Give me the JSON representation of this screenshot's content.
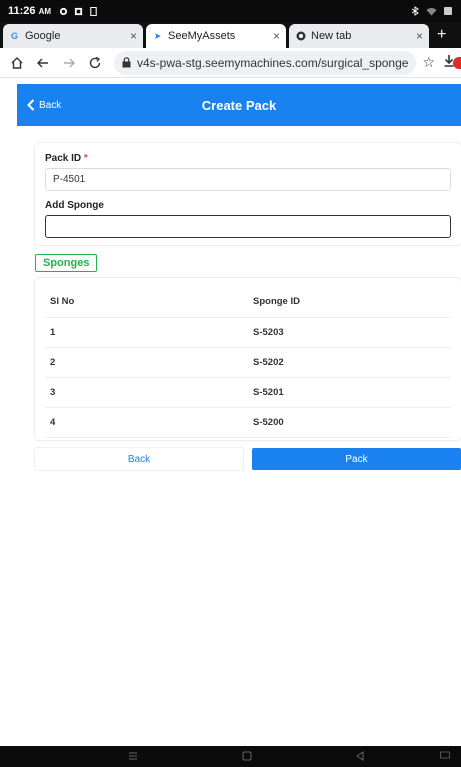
{
  "status_bar": {
    "time": "11:26",
    "ampm": "AM"
  },
  "browser": {
    "tabs": [
      {
        "label": "Google",
        "favicon": "google-icon",
        "active": false
      },
      {
        "label": "SeeMyAssets",
        "favicon": "seemyassets-icon",
        "active": true
      },
      {
        "label": "New tab",
        "favicon": "chrome-icon",
        "active": false
      }
    ],
    "url": "v4s-pwa-stg.seemymachines.com/surgical_sponge"
  },
  "header": {
    "back_label": "Back",
    "title": "Create Pack"
  },
  "form": {
    "pack_id_label": "Pack ID",
    "required_mark": "*",
    "pack_id_value": "P-4501",
    "add_sponge_label": "Add Sponge",
    "add_sponge_value": ""
  },
  "sponges_badge": "Sponges",
  "table": {
    "headers": [
      "Sl No",
      "Sponge ID"
    ],
    "rows": [
      [
        "1",
        "S-5203"
      ],
      [
        "2",
        "S-5202"
      ],
      [
        "3",
        "S-5201"
      ],
      [
        "4",
        "S-5200"
      ]
    ]
  },
  "buttons": {
    "back": "Back",
    "pack": "Pack"
  },
  "colors": {
    "primary": "#1a82f0",
    "success": "#23b14d",
    "required": "#e24a3b"
  }
}
